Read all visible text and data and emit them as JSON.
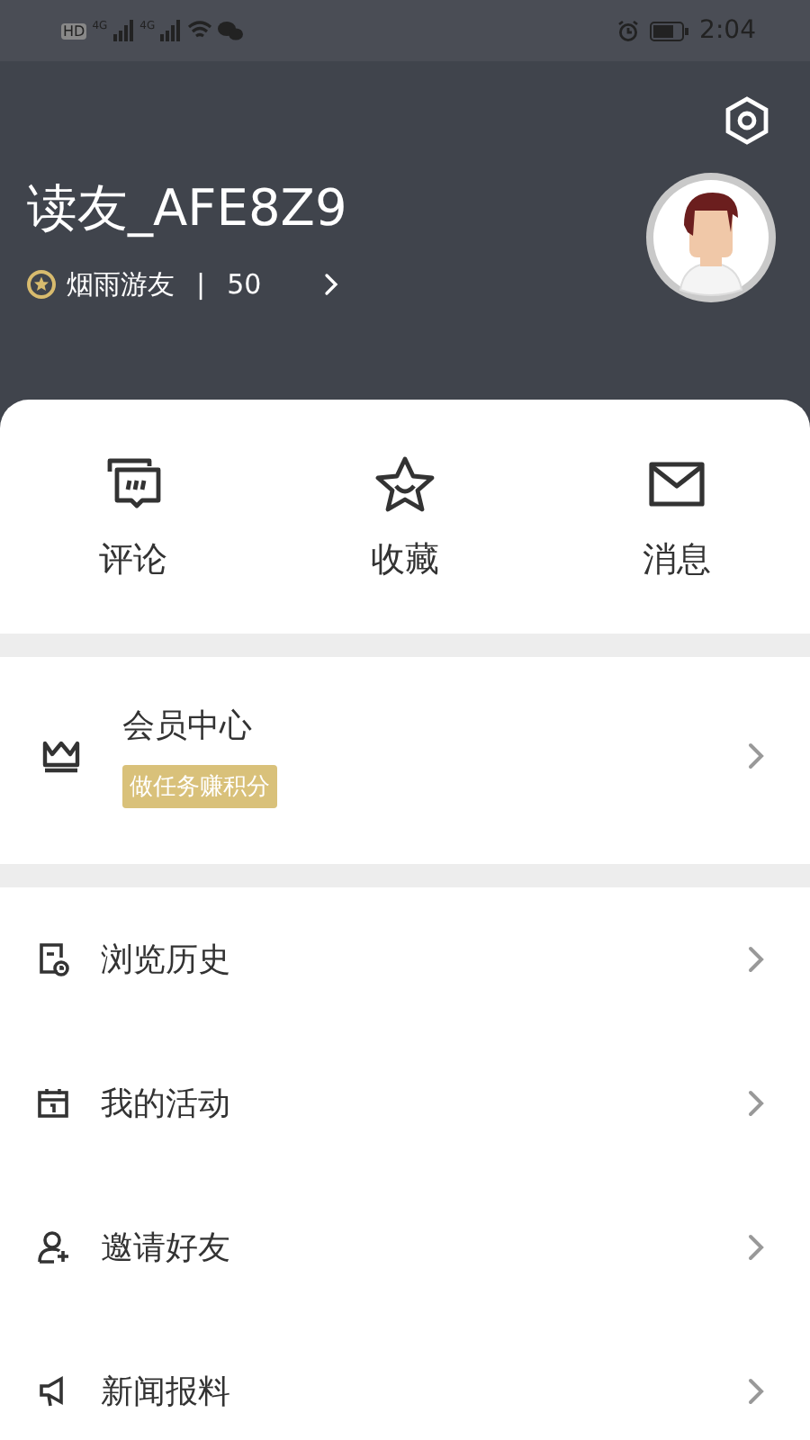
{
  "status_bar": {
    "left_labels": [
      "HD",
      "4G",
      "4G"
    ],
    "time": "2:04"
  },
  "profile": {
    "name": "读友_AFE8Z9",
    "level_name": "烟雨游友",
    "separator": "|",
    "points": "50"
  },
  "quick_actions": [
    {
      "kind": "comment",
      "label": "评论"
    },
    {
      "kind": "favorite",
      "label": "收藏"
    },
    {
      "kind": "message",
      "label": "消息"
    }
  ],
  "member": {
    "title": "会员中心",
    "tag": "做任务赚积分"
  },
  "menu": [
    {
      "kind": "history",
      "label": "浏览历史"
    },
    {
      "kind": "activity",
      "label": "我的活动"
    },
    {
      "kind": "invite",
      "label": "邀请好友"
    },
    {
      "kind": "report",
      "label": "新闻报料"
    }
  ]
}
